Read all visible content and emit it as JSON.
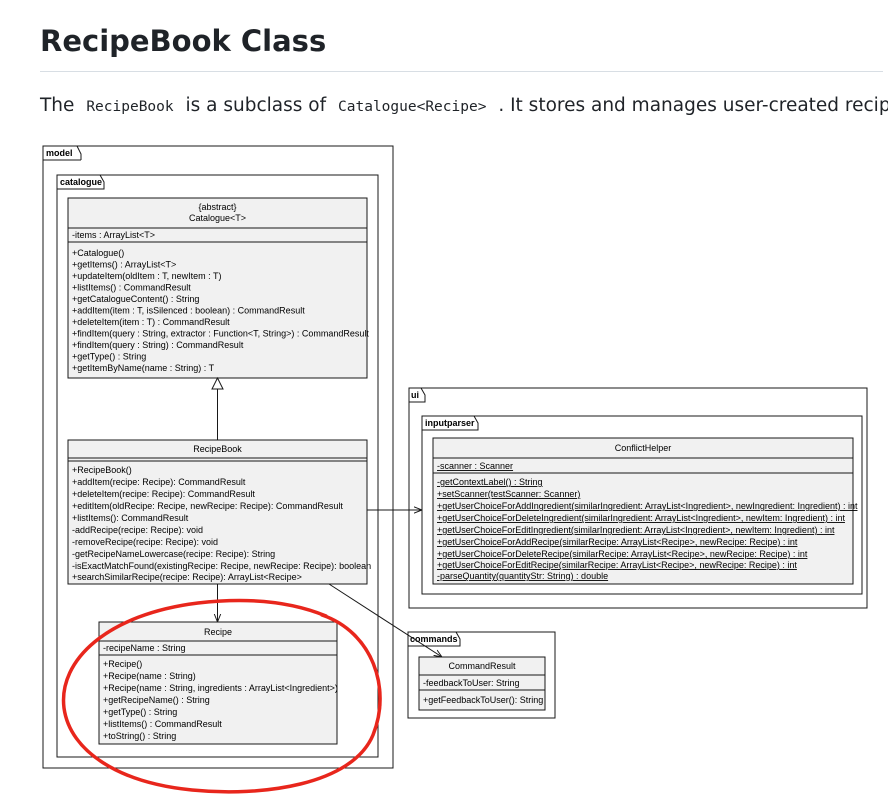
{
  "heading": "RecipeBook Class",
  "intro": {
    "text_before": "The",
    "code_1": "RecipeBook",
    "text_middle": "is a subclass of",
    "code_2": "Catalogue<Recipe>",
    "text_after": ". It stores and manages user-created recipes."
  },
  "packages": {
    "model": "model",
    "catalogue": "catalogue",
    "ui": "ui",
    "inputparser": "inputparser",
    "commands": "commands"
  },
  "classes": {
    "catalogue": {
      "stereotype": "{abstract}",
      "name": "Catalogue<T>",
      "attributes": [
        "-items : ArrayList<T>"
      ],
      "methods": [
        "+Catalogue()",
        "+getItems() : ArrayList<T>",
        "+updateItem(oldItem : T, newItem : T)",
        "+listItems() : CommandResult",
        "+getCatalogueContent() : String",
        "+addItem(item : T, isSilenced : boolean) : CommandResult",
        "+deleteItem(item : T) : CommandResult",
        "+findItem(query : String, extractor : Function<T, String>) : CommandResult",
        "+findItem(query : String) : CommandResult",
        "+getType() : String",
        "+getItemByName(name : String) : T"
      ]
    },
    "recipebook": {
      "name": "RecipeBook",
      "methods": [
        "+RecipeBook()",
        "+addItem(recipe: Recipe): CommandResult",
        "+deleteItem(recipe: Recipe): CommandResult",
        "+editItem(oldRecipe: Recipe, newRecipe: Recipe): CommandResult",
        "+listItems(): CommandResult",
        "-addRecipe(recipe: Recipe): void",
        "-removeRecipe(recipe: Recipe): void",
        "-getRecipeNameLowercase(recipe: Recipe): String",
        "-isExactMatchFound(existingRecipe: Recipe, newRecipe: Recipe): boolean",
        "+searchSimilarRecipe(recipe: Recipe): ArrayList<Recipe>"
      ]
    },
    "recipe": {
      "name": "Recipe",
      "attributes": [
        "-recipeName : String"
      ],
      "methods": [
        "+Recipe()",
        "+Recipe(name : String)",
        "+Recipe(name : String, ingredients : ArrayList<Ingredient>)",
        "+getRecipeName() : String",
        "+getType() : String",
        "+listItems() : CommandResult",
        "+toString() : String"
      ]
    },
    "conflicthelper": {
      "name": "ConflictHelper",
      "attributes": [
        "-scanner : Scanner"
      ],
      "methods": [
        "-getContextLabel() : String",
        "+setScanner(testScanner: Scanner)",
        "+getUserChoiceForAddIngredient(similarIngredient: ArrayList<Ingredient>, newIngredient: Ingredient) : int",
        "+getUserChoiceForDeleteIngredient(similarIngredient: ArrayList<Ingredient>, newItem: Ingredient) : int",
        "+getUserChoiceForEditIngredient(similarIngredient: ArrayList<Ingredient>, newItem: Ingredient) : int",
        "+getUserChoiceForAddRecipe(similarRecipe: ArrayList<Recipe>, newRecipe: Recipe) : int",
        "+getUserChoiceForDeleteRecipe(similarRecipe: ArrayList<Recipe>, newRecipe: Recipe) : int",
        "+getUserChoiceForEditRecipe(similarRecipe: ArrayList<Recipe>, newRecipe: Recipe) : int",
        "-parseQuantity(quantityStr: String) : double"
      ]
    },
    "commandresult": {
      "name": "CommandResult",
      "attributes": [
        "-feedbackToUser: String"
      ],
      "methods": [
        "+getFeedbackToUser(): String"
      ]
    }
  },
  "colors": {
    "class_fill": "#f1f1f1",
    "border": "#181818",
    "highlight": "#e8261c",
    "heading_text": "#1f2328",
    "rule": "#d8dee4"
  }
}
